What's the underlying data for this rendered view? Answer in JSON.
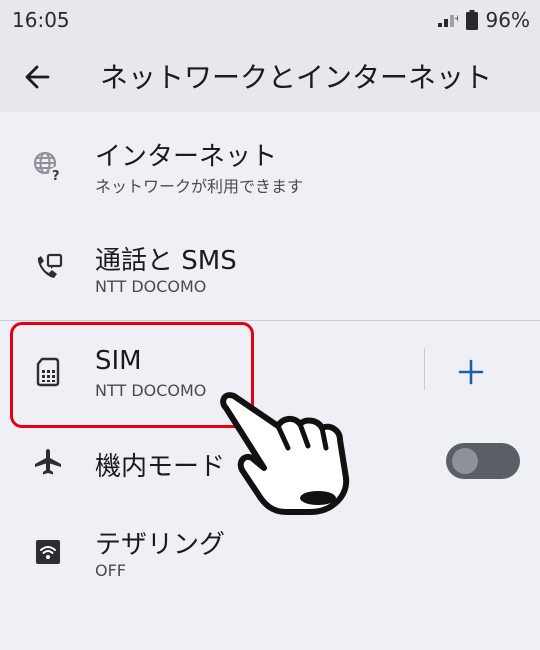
{
  "status": {
    "time": "16:05",
    "battery": "96%"
  },
  "appbar": {
    "title": "ネットワークとインターネット"
  },
  "items": [
    {
      "title": "インターネット",
      "subtitle": "ネットワークが利用できます",
      "icon": "globe-question-icon"
    },
    {
      "title": "通話と SMS",
      "subtitle": "NTT DOCOMO",
      "icon": "phone-message-icon"
    },
    {
      "title": "SIM",
      "subtitle": "NTT DOCOMO",
      "icon": "sim-card-icon"
    },
    {
      "title": "機内モード",
      "subtitle": "",
      "icon": "airplane-icon",
      "toggle_on": false
    },
    {
      "title": "テザリング",
      "subtitle": "OFF",
      "icon": "hotspot-icon"
    }
  ],
  "colors": {
    "accent": "#1d5fa1",
    "highlight": "#e60012",
    "background": "#eef0f6"
  }
}
